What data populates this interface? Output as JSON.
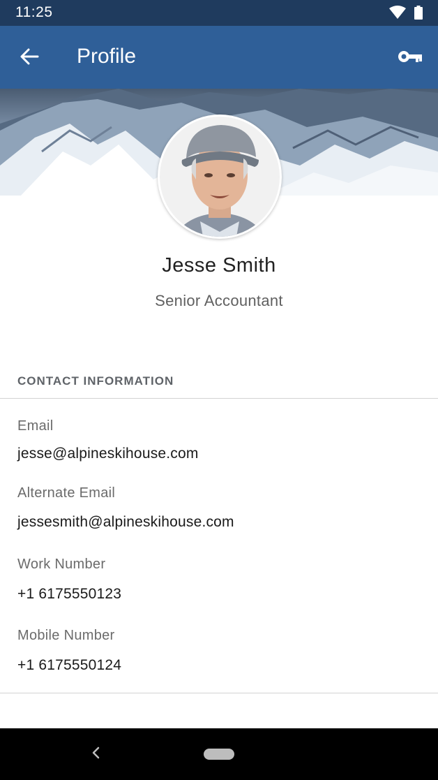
{
  "status_bar": {
    "time": "11:25"
  },
  "app_bar": {
    "title": "Profile"
  },
  "profile": {
    "name": "Jesse Smith",
    "job_title": "Senior Accountant"
  },
  "contact": {
    "header": "CONTACT INFORMATION",
    "fields": [
      {
        "label": "Email",
        "value": "jesse@alpineskihouse.com"
      },
      {
        "label": "Alternate Email",
        "value": "jessesmith@alpineskihouse.com"
      },
      {
        "label": "Work Number",
        "value": "+1 6175550123"
      },
      {
        "label": "Mobile Number",
        "value": "+1 6175550124"
      }
    ]
  },
  "colors": {
    "status_bar": "#1f3b5e",
    "app_bar": "#2f5f98",
    "nav_bar": "#000000"
  },
  "icons": {
    "status": [
      "wifi-icon",
      "battery-icon"
    ],
    "app_bar": [
      "back-arrow-icon",
      "key-icon"
    ],
    "nav": [
      "nav-back-icon",
      "home-pill-icon"
    ]
  }
}
